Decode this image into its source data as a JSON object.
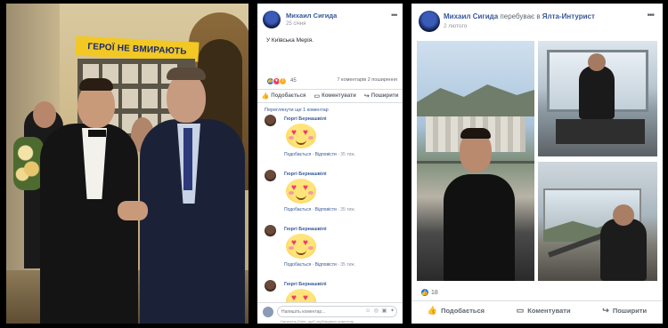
{
  "left_photo": {
    "banner_text": "ГЕРОЇ НЕ ВМИРАЮТЬ"
  },
  "post_middle": {
    "author": "Михаил Сигида",
    "date": "25 січня",
    "more": "•••",
    "place_text": "У Київська Мерія.",
    "reaction_icons": [
      "like",
      "love",
      "wow"
    ],
    "reaction_count": "45",
    "stats": "7 коментарів  2 поширення",
    "actions": {
      "like": "Подобається",
      "comment": "Коментувати",
      "share": "Поширити"
    },
    "view_previous": "Переглянути ще 1 коментар",
    "comments": [
      {
        "author": "Гюргі Бернашвілі",
        "reply": "Подобається",
        "answer": "Відповісти",
        "time": "35 тиж."
      },
      {
        "author": "Гюргі Бернашвілі",
        "reply": "Подобається",
        "answer": "Відповісти",
        "time": "35 тиж."
      },
      {
        "author": "Гюргі Бернашвілі",
        "reply": "Подобається",
        "answer": "Відповісти",
        "time": "35 тиж."
      },
      {
        "author": "Гюргі Бернашвілі",
        "reply": "",
        "answer": "",
        "time": ""
      }
    ],
    "write_placeholder": "Напишіть коментар...",
    "write_hint": "Натисніть Enter, щоб опублікувати коментар."
  },
  "post_right": {
    "author": "Михаил Сигида",
    "verb": " перебуває в ",
    "place": "Ялта-Интурист",
    "date": "2 лютого",
    "more": "•••",
    "reaction_icons": [
      "like"
    ],
    "reaction_count": "18",
    "actions": {
      "like": "Подобається",
      "comment": "Коментувати",
      "share": "Поширити"
    }
  },
  "colors": {
    "fb_blue": "#385898",
    "like_blue": "#2078f4",
    "love_red": "#f33e58",
    "wow_yellow": "#f7b125",
    "banner_yellow": "#f2c824"
  }
}
